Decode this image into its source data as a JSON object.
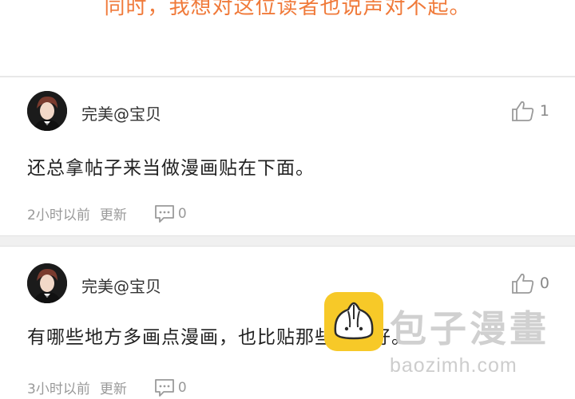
{
  "banner": {
    "text": "同时，我想对这位读者也说声对不起。"
  },
  "comments": [
    {
      "username": "完美@宝贝",
      "like_count": "1",
      "content": "还总拿帖子来当做漫画贴在下面。",
      "time": "2小时以前",
      "update_label": "更新",
      "reply_count": "0"
    },
    {
      "username": "完美@宝贝",
      "like_count": "0",
      "content": "有哪些地方多画点漫画，也比贴那些帖子好。",
      "time": "3小时以前",
      "update_label": "更新",
      "reply_count": "0"
    }
  ],
  "watermark": {
    "title": "包子漫畫",
    "url": "baozimh.com"
  },
  "colors": {
    "accent": "#f07a3a",
    "meta": "#999999",
    "logo": "#f7c928"
  },
  "icons": {
    "like": "thumbs-up-icon",
    "reply": "comment-bubble-icon"
  }
}
